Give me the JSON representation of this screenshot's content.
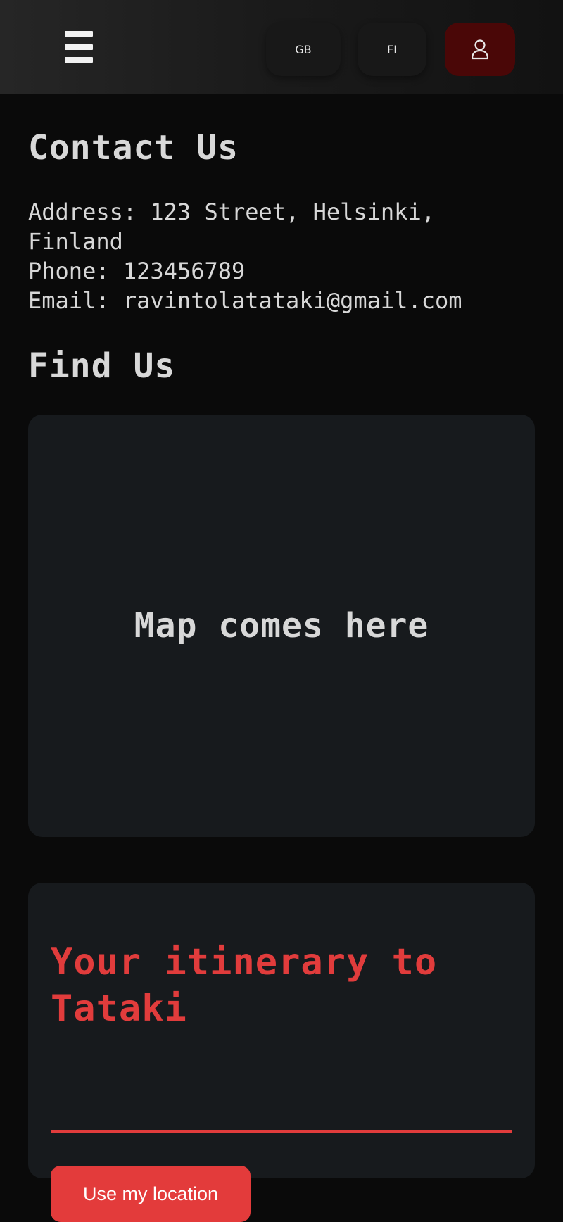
{
  "header": {
    "menu_icon": "hamburger-menu-icon",
    "language_buttons": [
      {
        "label": "GB"
      },
      {
        "label": "FI"
      }
    ],
    "profile_icon": "user-icon",
    "profile_color": "#4a0707"
  },
  "contact": {
    "title": "Contact Us",
    "address": "Address: 123 Street, Helsinki, Finland",
    "phone": "Phone: 123456789",
    "email": "Email: ravintolatataki@gmail.com"
  },
  "find": {
    "title": "Find Us",
    "map_placeholder": "Map comes here"
  },
  "itinerary": {
    "title": "Your itinerary to Tataki",
    "location_button": "Use my location",
    "accent_color": "#e33b3b"
  }
}
